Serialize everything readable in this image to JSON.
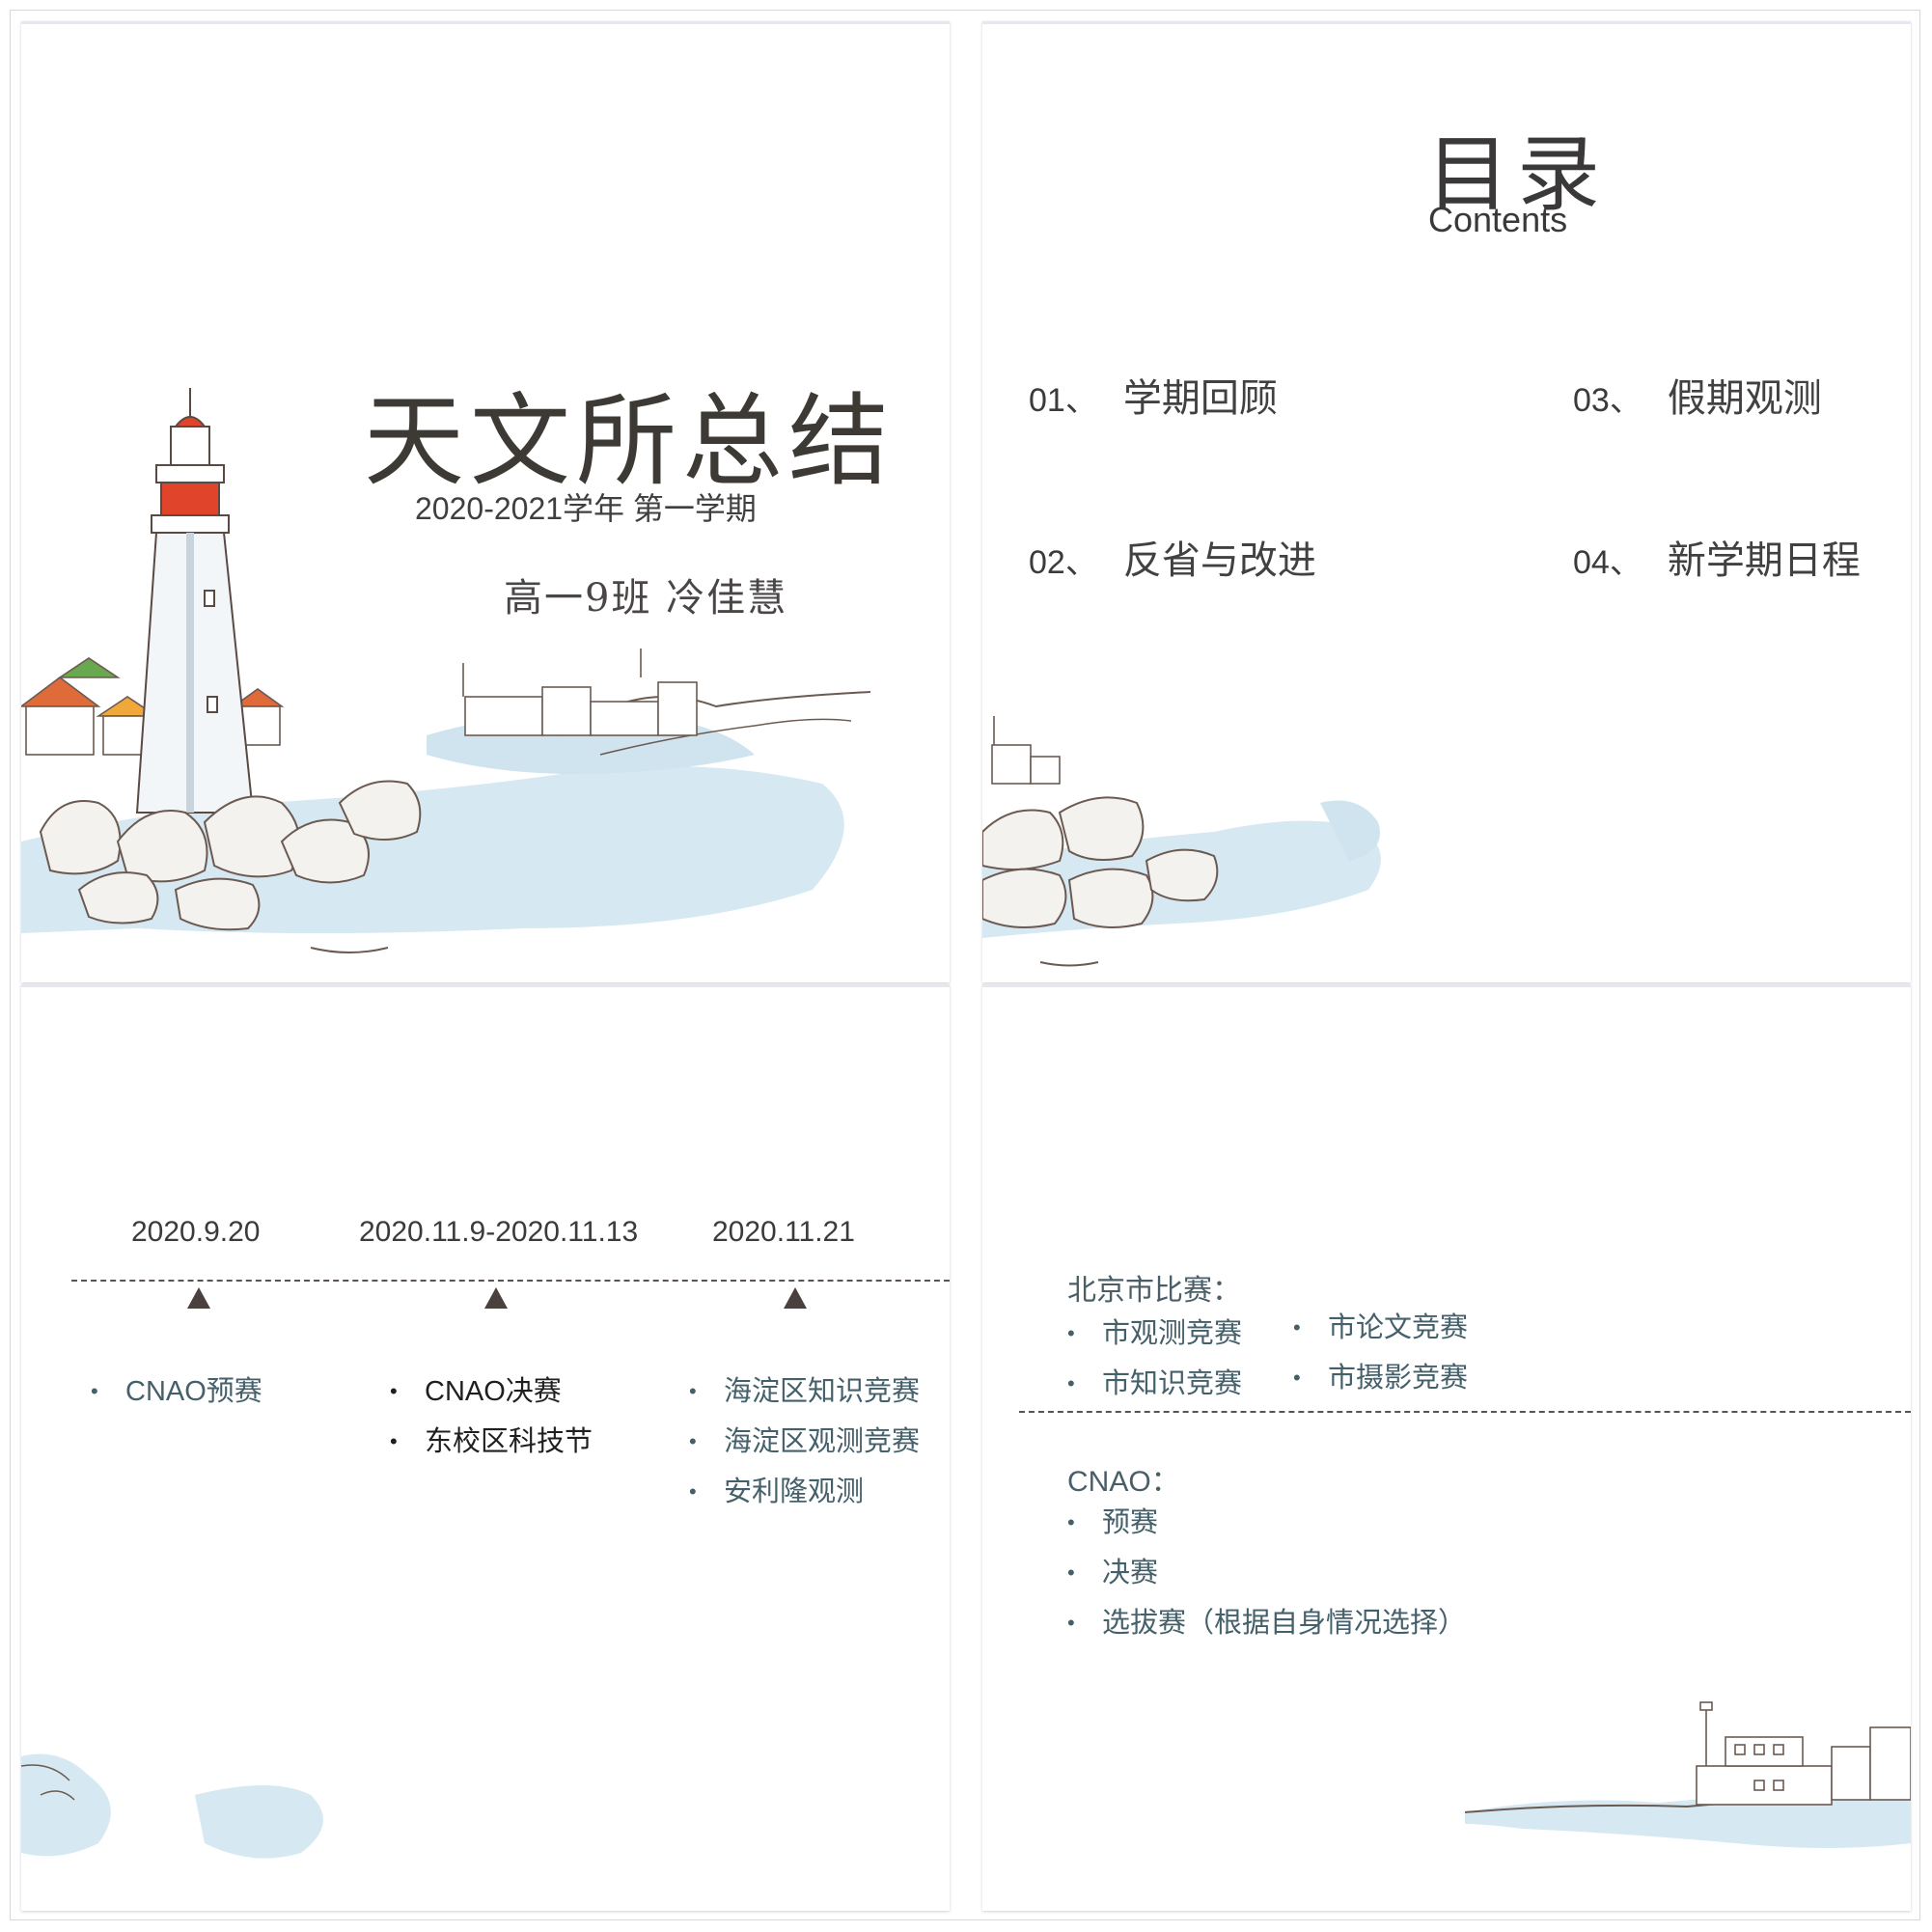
{
  "slide1": {
    "title": "天文所总结",
    "subtitle": "2020-2021学年 第一学期",
    "author": "高一9班  冷佳慧"
  },
  "slide2": {
    "title": "目录",
    "subtitle": "Contents",
    "items": [
      {
        "num": "01、",
        "label": "学期回顾"
      },
      {
        "num": "02、",
        "label": "反省与改进"
      },
      {
        "num": "03、",
        "label": "假期观测"
      },
      {
        "num": "04、",
        "label": "新学期日程"
      }
    ]
  },
  "slide3": {
    "timeline": [
      {
        "date": "2020.9.20",
        "events": [
          "CNAO预赛"
        ]
      },
      {
        "date": "2020.11.9-2020.11.13",
        "events": [
          "CNAO决赛",
          "东校区科技节"
        ]
      },
      {
        "date": "2020.11.21",
        "events": [
          "海淀区知识竞赛",
          "海淀区观测竞赛",
          "安利隆观测"
        ]
      }
    ]
  },
  "slide4": {
    "beijing": {
      "title": "北京市比赛：",
      "items": [
        "市观测竞赛",
        "市论文竞赛",
        "市知识竞赛",
        "市摄影竞赛"
      ]
    },
    "cnao": {
      "title": "CNAO：",
      "items": [
        "预赛",
        "决赛",
        "选拔赛（根据自身情况选择）"
      ]
    }
  },
  "colors": {
    "text_dark": "#3d3a36",
    "teal_text": "#44606b",
    "sea_blue": "#cfe4ee",
    "lighthouse_red": "#e0452b"
  }
}
